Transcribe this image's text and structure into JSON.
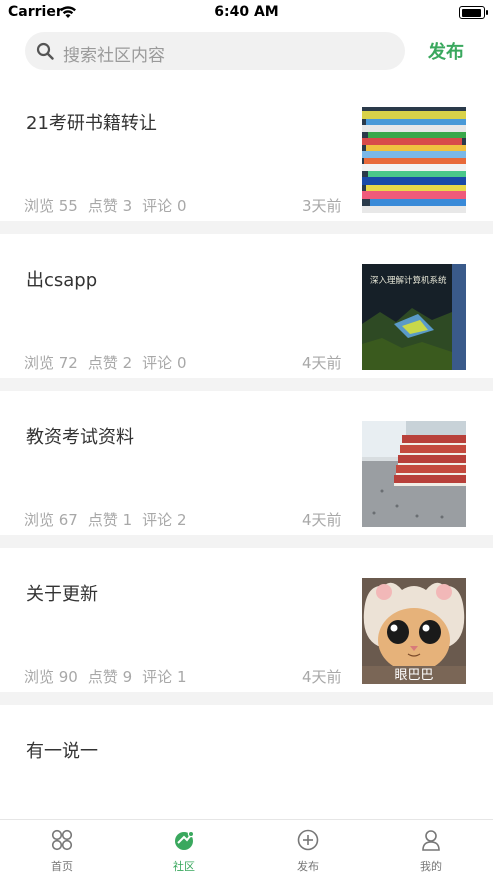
{
  "status_bar": {
    "carrier": "Carrier",
    "time": "6:40 AM"
  },
  "search": {
    "placeholder": "搜索社区内容",
    "publish_label": "发布"
  },
  "colors": {
    "accent": "#3aa85e",
    "meta_gray": "#a8a8a8",
    "divider": "#f3f3f3"
  },
  "posts": [
    {
      "title": "21考研书籍转让",
      "views": "浏览 55",
      "likes": "点赞 3",
      "comments": "评论 0",
      "time": "3天前",
      "thumb_icon": "books-photo"
    },
    {
      "title": "出csapp",
      "views": "浏览 72",
      "likes": "点赞 2",
      "comments": "评论 0",
      "time": "4天前",
      "thumb_icon": "csapp-book-photo",
      "thumb_text": "深入理解计算机系统"
    },
    {
      "title": "教资考试资料",
      "views": "浏览 67",
      "likes": "点赞 1",
      "comments": "评论 2",
      "time": "4天前",
      "thumb_icon": "study-books-photo"
    },
    {
      "title": "关于更新",
      "views": "浏览 90",
      "likes": "点赞 9",
      "comments": "评论 1",
      "time": "4天前",
      "thumb_icon": "cat-meme-photo",
      "thumb_text": "眼巴巴"
    },
    {
      "title": "有一说一"
    }
  ],
  "tabbar": {
    "items": [
      {
        "label": "首页",
        "icon": "home-grid-icon"
      },
      {
        "label": "社区",
        "icon": "community-icon",
        "active": true
      },
      {
        "label": "发布",
        "icon": "plus-circle-icon"
      },
      {
        "label": "我的",
        "icon": "user-icon"
      }
    ]
  }
}
